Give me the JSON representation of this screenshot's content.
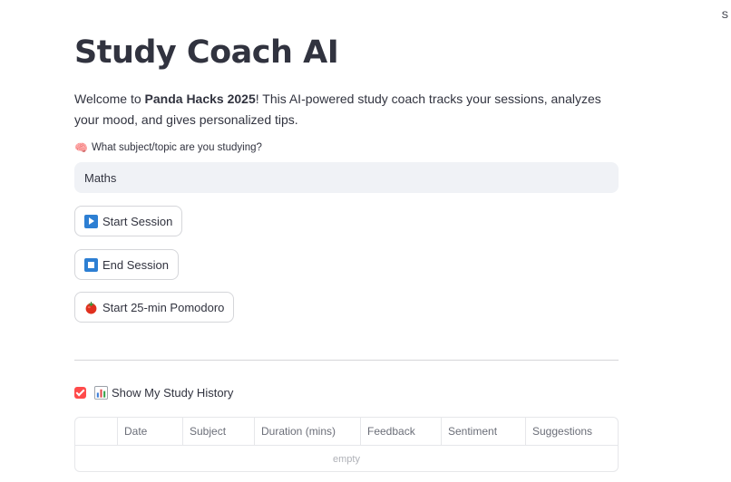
{
  "corner": {
    "text": "S"
  },
  "page": {
    "title": "Study Coach AI",
    "intro_prefix": "Welcome to ",
    "intro_bold": "Panda Hacks 2025",
    "intro_suffix": "! This AI-powered study coach tracks your sessions, analyzes your mood, and gives personalized tips."
  },
  "subject_field": {
    "icon": "brain-icon",
    "label": "What subject/topic are you studying?",
    "value": "Maths"
  },
  "buttons": {
    "start_session": {
      "icon": "play-button-icon",
      "label": "Start Session"
    },
    "end_session": {
      "icon": "stop-button-icon",
      "label": "End Session"
    },
    "pomodoro": {
      "icon": "tomato-icon",
      "label": "Start 25-min Pomodoro"
    }
  },
  "history_toggle": {
    "checked": true,
    "icon": "bar-chart-icon",
    "label": "Show My Study History"
  },
  "history_table": {
    "columns": [
      "Date",
      "Subject",
      "Duration (mins)",
      "Feedback",
      "Sentiment",
      "Suggestions"
    ],
    "empty_text": "empty"
  },
  "colors": {
    "accent": "#ff4b4b",
    "button_icon_blue": "#2d7fd3",
    "input_background": "#f0f2f6",
    "text": "#31333f"
  }
}
